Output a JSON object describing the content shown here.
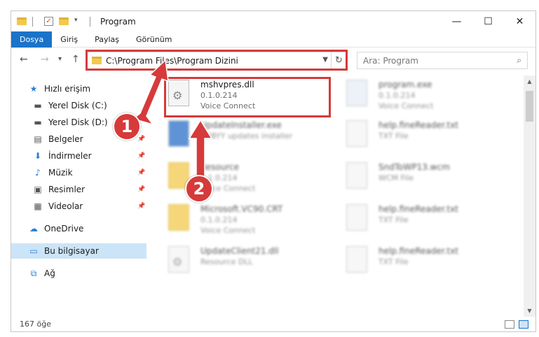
{
  "window": {
    "title": "Program"
  },
  "ribbon": {
    "tabs": [
      "Dosya",
      "Giriş",
      "Paylaş",
      "Görünüm"
    ]
  },
  "address": {
    "path": "C:\\Program Files\\Program Dizini"
  },
  "search": {
    "placeholder": "Ara: Program"
  },
  "sidebar": {
    "items": [
      {
        "label": "Hızlı erişim",
        "icon": "star-icon"
      },
      {
        "label": "Yerel Disk (C:)",
        "icon": "drive-icon"
      },
      {
        "label": "Yerel Disk (D:)",
        "icon": "drive-icon"
      },
      {
        "label": "Belgeler",
        "icon": "documents-icon"
      },
      {
        "label": "İndirmeler",
        "icon": "download-icon"
      },
      {
        "label": "Müzik",
        "icon": "music-icon"
      },
      {
        "label": "Resimler",
        "icon": "pictures-icon"
      },
      {
        "label": "Videolar",
        "icon": "video-icon"
      },
      {
        "label": "OneDrive",
        "icon": "cloud-icon"
      },
      {
        "label": "Bu bilgisayar",
        "icon": "computer-icon"
      },
      {
        "label": "Ağ",
        "icon": "network-icon"
      }
    ]
  },
  "files": [
    {
      "name": "mshvpres.dll",
      "line2": "0.1.0.214",
      "line3": "Voice Connect"
    },
    {
      "name": "program.exe",
      "line2": "0.1.0.214",
      "line3": "Voice Connect"
    },
    {
      "name": "UpdateInstaller.exe",
      "line2": "ABBYY updates installer",
      "line3": ""
    },
    {
      "name": "help.fineReader.txt",
      "line2": "TXT File",
      "line3": ""
    },
    {
      "name": "Resource",
      "line2": "0.1.0.214",
      "line3": "Voice Connect"
    },
    {
      "name": "SndToWP13.wcm",
      "line2": "WCM File",
      "line3": ""
    },
    {
      "name": "Microsoft.VC90.CRT",
      "line2": "0.1.0.214",
      "line3": "Voice Connect"
    },
    {
      "name": "help.fineReader.txt",
      "line2": "TXT File",
      "line3": ""
    },
    {
      "name": "UpdateClient21.dll",
      "line2": "Resource DLL",
      "line3": ""
    },
    {
      "name": "help.fineReader.txt",
      "line2": "TXT File",
      "line3": ""
    }
  ],
  "status": {
    "count": "167 öğe"
  },
  "annotations": {
    "badge1": "1",
    "badge2": "2"
  },
  "colors": {
    "accent": "#1a73c9",
    "highlight": "#d63a3a",
    "selected": "#cce4f7"
  }
}
